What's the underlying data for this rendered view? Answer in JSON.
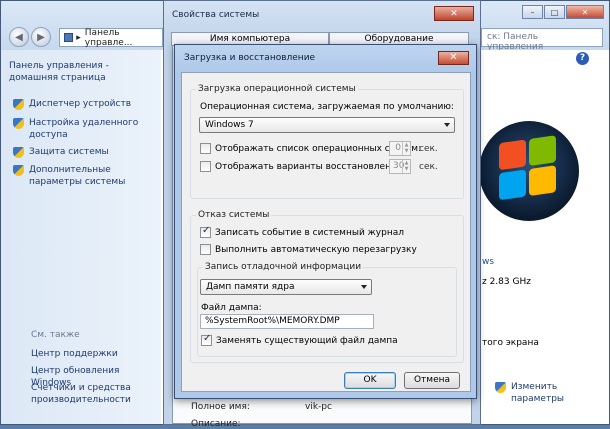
{
  "control_panel": {
    "address": "Панель управле...",
    "search_placeholder": "ск: Панель управления",
    "home_link": "Панель управления - домашняя страница",
    "side_links": [
      "Диспетчер устройств",
      "Настройка удаленного доступа",
      "Защита системы",
      "Дополнительные параметры системы"
    ],
    "see_also_title": "См. также",
    "see_also_links": [
      "Центр поддержки",
      "Центр обновления Windows",
      "Счетчики и средства производительности"
    ],
    "cpu_frequency": "z  2.83 GHz",
    "screen_fragment": "того экрана",
    "ws_fragment": "ws",
    "change_settings": "Изменить параметры"
  },
  "system_properties": {
    "title": "Свойства системы",
    "close_label": "✕",
    "tabs": [
      "Имя компьютера",
      "Оборудование"
    ],
    "full_name_label": "Полное имя:",
    "full_name_value": "vik-pc",
    "description_label": "Описание:"
  },
  "boot_dialog": {
    "title": "Загрузка и восстановление",
    "close_label": "✕",
    "startup_group": "Загрузка операционной системы",
    "default_os_label": "Операционная система, загружаемая по умолчанию:",
    "default_os_value": "Windows 7",
    "show_os_list_label": "Отображать список операционных систем:",
    "show_os_list_value": "0",
    "show_recovery_label": "Отображать варианты восстановления:",
    "show_recovery_value": "30",
    "seconds_unit": "сек.",
    "failure_group": "Отказ системы",
    "write_event_label": "Записать событие в системный журнал",
    "auto_restart_label": "Выполнить автоматическую перезагрузку",
    "debug_group": "Запись отладочной информации",
    "debug_type_value": "Дамп памяти ядра",
    "dump_file_label": "Файл дампа:",
    "dump_file_value": "%SystemRoot%\\MEMORY.DMP",
    "overwrite_label": "Заменять существующий файл дампа",
    "ok_label": "OK",
    "cancel_label": "Отмена"
  },
  "checkbox_states": {
    "show_os_list": false,
    "show_recovery": false,
    "write_event": true,
    "auto_restart": false,
    "overwrite": true
  }
}
